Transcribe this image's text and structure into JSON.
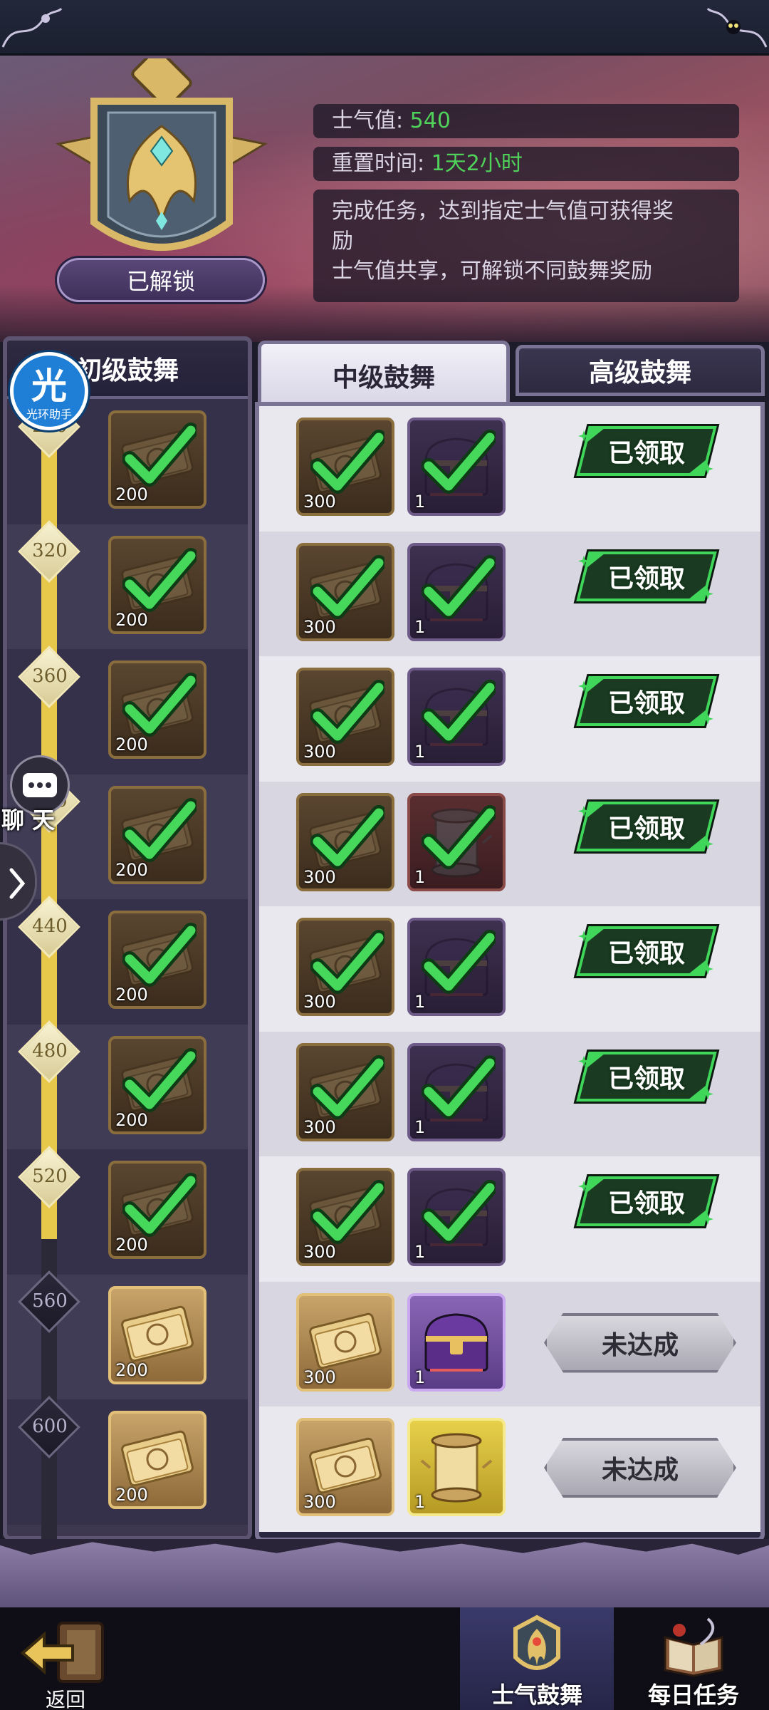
{
  "header": {
    "badge_status": "已解锁",
    "morale_label": "士气值:",
    "morale_value": "540",
    "reset_label": "重置时间:",
    "reset_value": "1天2小时",
    "desc_line1": "完成任务，达到指定士气值可获得奖",
    "desc_line2": "励",
    "desc_line3": "士气值共享，可解锁不同鼓舞奖励"
  },
  "helper": {
    "char": "光",
    "label": "光环助手"
  },
  "chat": {
    "label": "聊 天"
  },
  "tabs": {
    "beginner": "初级鼓舞",
    "intermediate": "中级鼓舞",
    "advanced": "高级鼓舞"
  },
  "milestones": [
    {
      "threshold": "280",
      "free_qty": "200",
      "paid_ticket_qty": "300",
      "paid_item_qty": "1",
      "paid_item": "chest",
      "status": "已领取",
      "claimed": true
    },
    {
      "threshold": "320",
      "free_qty": "200",
      "paid_ticket_qty": "300",
      "paid_item_qty": "1",
      "paid_item": "chest",
      "status": "已领取",
      "claimed": true
    },
    {
      "threshold": "360",
      "free_qty": "200",
      "paid_ticket_qty": "300",
      "paid_item_qty": "1",
      "paid_item": "chest",
      "status": "已领取",
      "claimed": true
    },
    {
      "threshold": "400",
      "free_qty": "200",
      "paid_ticket_qty": "300",
      "paid_item_qty": "1",
      "paid_item": "scroll",
      "status": "已领取",
      "claimed": true
    },
    {
      "threshold": "440",
      "free_qty": "200",
      "paid_ticket_qty": "300",
      "paid_item_qty": "1",
      "paid_item": "chest",
      "status": "已领取",
      "claimed": true
    },
    {
      "threshold": "480",
      "free_qty": "200",
      "paid_ticket_qty": "300",
      "paid_item_qty": "1",
      "paid_item": "chest",
      "status": "已领取",
      "claimed": true
    },
    {
      "threshold": "520",
      "free_qty": "200",
      "paid_ticket_qty": "300",
      "paid_item_qty": "1",
      "paid_item": "chest",
      "status": "已领取",
      "claimed": true
    },
    {
      "threshold": "560",
      "free_qty": "200",
      "paid_ticket_qty": "300",
      "paid_item_qty": "1",
      "paid_item": "chest",
      "status": "未达成",
      "claimed": false
    },
    {
      "threshold": "600",
      "free_qty": "200",
      "paid_ticket_qty": "300",
      "paid_item_qty": "1",
      "paid_item": "scroll",
      "status": "未达成",
      "claimed": false
    }
  ],
  "footer": {
    "back": "返回",
    "nav_morale": "士气鼓舞",
    "nav_daily": "每日任务"
  },
  "colors": {
    "accent_green": "#4fd25a",
    "progress_gold": "#e8c84a",
    "panel_purple": "#3d3850"
  }
}
